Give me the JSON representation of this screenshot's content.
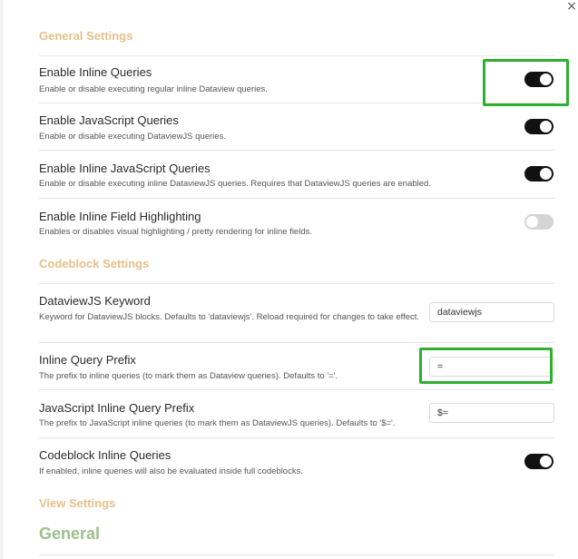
{
  "window": {
    "close_glyph": "×"
  },
  "sections": {
    "general": "General Settings",
    "codeblock": "Codeblock Settings",
    "view": "View Settings"
  },
  "settings": {
    "inline_queries": {
      "name": "Enable Inline Queries",
      "desc": "Enable or disable executing regular inline Dataview queries.",
      "enabled": true
    },
    "js_queries": {
      "name": "Enable JavaScript Queries",
      "desc": "Enable or disable executing DataviewJS queries.",
      "enabled": true
    },
    "inline_js_queries": {
      "name": "Enable Inline JavaScript Queries",
      "desc": "Enable or disable executing inline DataviewJS queries. Requires that DataviewJS queries are enabled.",
      "enabled": true
    },
    "inline_field_highlighting": {
      "name": "Enable Inline Field Highlighting",
      "desc": "Enables or disables visual highlighting / pretty rendering for inline fields.",
      "enabled": false
    },
    "dataviewjs_keyword": {
      "name": "DataviewJS Keyword",
      "desc": "Keyword for DataviewJS blocks. Defaults to 'dataviewjs'. Reload required for changes to take effect.",
      "value": "dataviewjs"
    },
    "inline_query_prefix": {
      "name": "Inline Query Prefix",
      "desc": "The prefix to inline queries (to mark them as Dataview queries). Defaults to '='.",
      "value": "="
    },
    "js_inline_query_prefix": {
      "name": "JavaScript Inline Query Prefix",
      "desc": "The prefix to JavaScript inline queries (to mark them as DataviewJS queries). Defaults to '$='.",
      "value": "$="
    },
    "codeblock_inline_queries": {
      "name": "Codeblock Inline Queries",
      "desc": "If enabled, inline queries will also be evaluated inside full codeblocks.",
      "enabled": true
    }
  },
  "view": {
    "general_heading": "General"
  },
  "colors": {
    "section_heading": "#e6c08a",
    "view_heading": "#9dc08b",
    "toggle_on": "#111111",
    "toggle_off": "#d4d4d4",
    "highlight": "#2fae2f"
  }
}
